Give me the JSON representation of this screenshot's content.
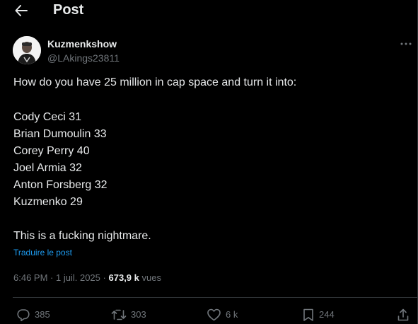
{
  "header": {
    "title": "Post"
  },
  "author": {
    "name": "Kuzmenkshow",
    "handle": "@LAkings23811"
  },
  "post": {
    "lines": [
      "How do you have 25 million in cap space and turn it into:",
      "Cody Ceci 31",
      "Brian Dumoulin 33",
      "Corey Perry 40",
      "Joel Armia 32",
      "Anton Forsberg 32",
      "Kuzmenko 29",
      "This is a fucking nightmare."
    ],
    "translate_label": "Traduire le post"
  },
  "meta": {
    "time": "6:46 PM",
    "separator": "·",
    "date": "1 juil. 2025",
    "views_count": "673,9 k",
    "views_label": "vues"
  },
  "actions": {
    "replies": "385",
    "reposts": "303",
    "likes": "6 k",
    "bookmarks": "244"
  },
  "colors": {
    "background": "#000000",
    "text": "#e7e9ea",
    "muted": "#71767b",
    "link": "#1d9bf0",
    "border": "#2f3336"
  },
  "icons": {
    "back": "arrow-left-icon",
    "more": "more-horizontal-icon",
    "reply": "reply-icon",
    "repost": "repost-icon",
    "like": "heart-icon",
    "bookmark": "bookmark-icon",
    "share": "share-icon"
  }
}
